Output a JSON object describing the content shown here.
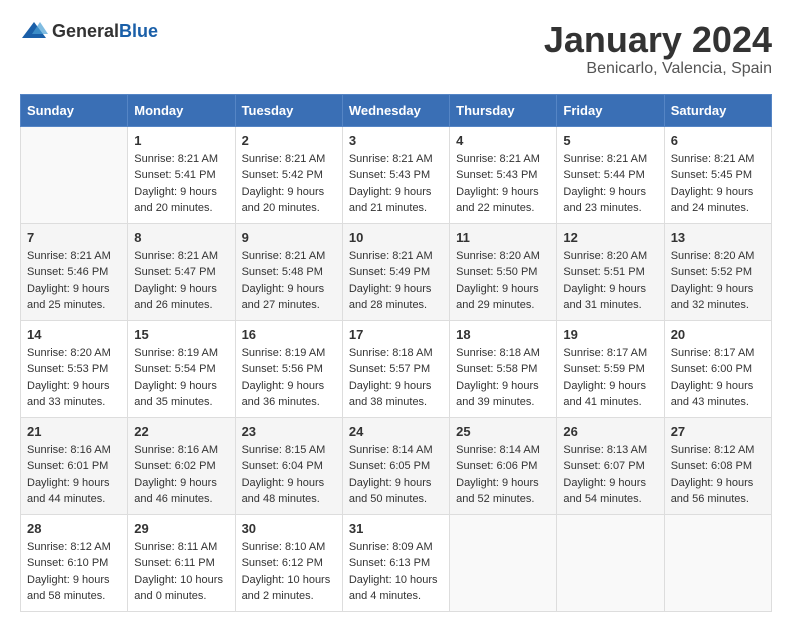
{
  "header": {
    "logo_general": "General",
    "logo_blue": "Blue",
    "month_title": "January 2024",
    "location": "Benicarlo, Valencia, Spain"
  },
  "weekdays": [
    "Sunday",
    "Monday",
    "Tuesday",
    "Wednesday",
    "Thursday",
    "Friday",
    "Saturday"
  ],
  "weeks": [
    [
      {
        "day": "",
        "info": ""
      },
      {
        "day": "1",
        "info": "Sunrise: 8:21 AM\nSunset: 5:41 PM\nDaylight: 9 hours\nand 20 minutes."
      },
      {
        "day": "2",
        "info": "Sunrise: 8:21 AM\nSunset: 5:42 PM\nDaylight: 9 hours\nand 20 minutes."
      },
      {
        "day": "3",
        "info": "Sunrise: 8:21 AM\nSunset: 5:43 PM\nDaylight: 9 hours\nand 21 minutes."
      },
      {
        "day": "4",
        "info": "Sunrise: 8:21 AM\nSunset: 5:43 PM\nDaylight: 9 hours\nand 22 minutes."
      },
      {
        "day": "5",
        "info": "Sunrise: 8:21 AM\nSunset: 5:44 PM\nDaylight: 9 hours\nand 23 minutes."
      },
      {
        "day": "6",
        "info": "Sunrise: 8:21 AM\nSunset: 5:45 PM\nDaylight: 9 hours\nand 24 minutes."
      }
    ],
    [
      {
        "day": "7",
        "info": "Sunrise: 8:21 AM\nSunset: 5:46 PM\nDaylight: 9 hours\nand 25 minutes."
      },
      {
        "day": "8",
        "info": "Sunrise: 8:21 AM\nSunset: 5:47 PM\nDaylight: 9 hours\nand 26 minutes."
      },
      {
        "day": "9",
        "info": "Sunrise: 8:21 AM\nSunset: 5:48 PM\nDaylight: 9 hours\nand 27 minutes."
      },
      {
        "day": "10",
        "info": "Sunrise: 8:21 AM\nSunset: 5:49 PM\nDaylight: 9 hours\nand 28 minutes."
      },
      {
        "day": "11",
        "info": "Sunrise: 8:20 AM\nSunset: 5:50 PM\nDaylight: 9 hours\nand 29 minutes."
      },
      {
        "day": "12",
        "info": "Sunrise: 8:20 AM\nSunset: 5:51 PM\nDaylight: 9 hours\nand 31 minutes."
      },
      {
        "day": "13",
        "info": "Sunrise: 8:20 AM\nSunset: 5:52 PM\nDaylight: 9 hours\nand 32 minutes."
      }
    ],
    [
      {
        "day": "14",
        "info": "Sunrise: 8:20 AM\nSunset: 5:53 PM\nDaylight: 9 hours\nand 33 minutes."
      },
      {
        "day": "15",
        "info": "Sunrise: 8:19 AM\nSunset: 5:54 PM\nDaylight: 9 hours\nand 35 minutes."
      },
      {
        "day": "16",
        "info": "Sunrise: 8:19 AM\nSunset: 5:56 PM\nDaylight: 9 hours\nand 36 minutes."
      },
      {
        "day": "17",
        "info": "Sunrise: 8:18 AM\nSunset: 5:57 PM\nDaylight: 9 hours\nand 38 minutes."
      },
      {
        "day": "18",
        "info": "Sunrise: 8:18 AM\nSunset: 5:58 PM\nDaylight: 9 hours\nand 39 minutes."
      },
      {
        "day": "19",
        "info": "Sunrise: 8:17 AM\nSunset: 5:59 PM\nDaylight: 9 hours\nand 41 minutes."
      },
      {
        "day": "20",
        "info": "Sunrise: 8:17 AM\nSunset: 6:00 PM\nDaylight: 9 hours\nand 43 minutes."
      }
    ],
    [
      {
        "day": "21",
        "info": "Sunrise: 8:16 AM\nSunset: 6:01 PM\nDaylight: 9 hours\nand 44 minutes."
      },
      {
        "day": "22",
        "info": "Sunrise: 8:16 AM\nSunset: 6:02 PM\nDaylight: 9 hours\nand 46 minutes."
      },
      {
        "day": "23",
        "info": "Sunrise: 8:15 AM\nSunset: 6:04 PM\nDaylight: 9 hours\nand 48 minutes."
      },
      {
        "day": "24",
        "info": "Sunrise: 8:14 AM\nSunset: 6:05 PM\nDaylight: 9 hours\nand 50 minutes."
      },
      {
        "day": "25",
        "info": "Sunrise: 8:14 AM\nSunset: 6:06 PM\nDaylight: 9 hours\nand 52 minutes."
      },
      {
        "day": "26",
        "info": "Sunrise: 8:13 AM\nSunset: 6:07 PM\nDaylight: 9 hours\nand 54 minutes."
      },
      {
        "day": "27",
        "info": "Sunrise: 8:12 AM\nSunset: 6:08 PM\nDaylight: 9 hours\nand 56 minutes."
      }
    ],
    [
      {
        "day": "28",
        "info": "Sunrise: 8:12 AM\nSunset: 6:10 PM\nDaylight: 9 hours\nand 58 minutes."
      },
      {
        "day": "29",
        "info": "Sunrise: 8:11 AM\nSunset: 6:11 PM\nDaylight: 10 hours\nand 0 minutes."
      },
      {
        "day": "30",
        "info": "Sunrise: 8:10 AM\nSunset: 6:12 PM\nDaylight: 10 hours\nand 2 minutes."
      },
      {
        "day": "31",
        "info": "Sunrise: 8:09 AM\nSunset: 6:13 PM\nDaylight: 10 hours\nand 4 minutes."
      },
      {
        "day": "",
        "info": ""
      },
      {
        "day": "",
        "info": ""
      },
      {
        "day": "",
        "info": ""
      }
    ]
  ]
}
